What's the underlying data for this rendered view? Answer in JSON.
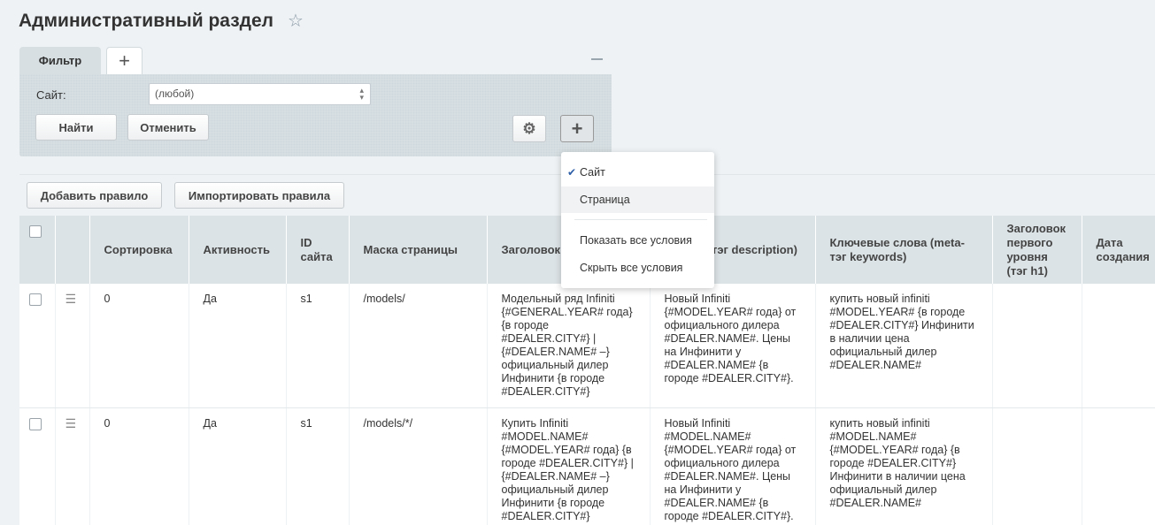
{
  "page": {
    "title": "Административный раздел"
  },
  "filter": {
    "tab_label": "Фильтр",
    "site_label": "Сайт:",
    "site_value": "(любой)",
    "find_label": "Найти",
    "cancel_label": "Отменить"
  },
  "dropdown": {
    "items": [
      "Сайт",
      "Страница",
      "Показать все условия",
      "Скрыть все условия"
    ]
  },
  "toolbar": {
    "add_rule": "Добавить правило",
    "import_rules": "Импортировать правила"
  },
  "table": {
    "headers": [
      "Сортировка",
      "Активность",
      "ID сайта",
      "Маска страницы",
      "Заголовок",
      "... (meta-тэг description)",
      "Ключевые слова (meta-тэг keywords)",
      "Заголовок первого уровня (тэг h1)",
      "Дата создания"
    ],
    "rows": [
      {
        "sort": "0",
        "active": "Да",
        "site": "s1",
        "mask": "/models/",
        "title": "Модельный ряд Infiniti {#GENERAL.YEAR# года} {в городе #DEALER.CITY#} | {#DEALER.NAME# –} официальный дилер Инфинити {в городе #DEALER.CITY#}",
        "description": "Новый Infiniti {#MODEL.YEAR# года} от официального дилера #DEALER.NAME#. Цены на Инфинити у #DEALER.NAME# {в городе #DEALER.CITY#}.",
        "keywords": "купить новый infiniti #MODEL.YEAR# {в городе #DEALER.CITY#} Инфинити в наличии цена официальный дилер #DEALER.NAME#"
      },
      {
        "sort": "0",
        "active": "Да",
        "site": "s1",
        "mask": "/models/*/",
        "title": "Купить Infiniti #MODEL.NAME# {#MODEL.YEAR# года} {в городе #DEALER.CITY#} | {#DEALER.NAME# –} официальный дилер Инфинити {в городе #DEALER.CITY#}",
        "description": "Новый Infiniti #MODEL.NAME# {#MODEL.YEAR# года} от официального дилера #DEALER.NAME#. Цены на Инфинити у #DEALER.NAME# {в городе #DEALER.CITY#}.",
        "keywords": "купить новый infiniti #MODEL.NAME# {#MODEL.YEAR# года} {в городе #DEALER.CITY#} Инфинити в наличии цена официальный дилер #DEALER.NAME#"
      }
    ]
  }
}
